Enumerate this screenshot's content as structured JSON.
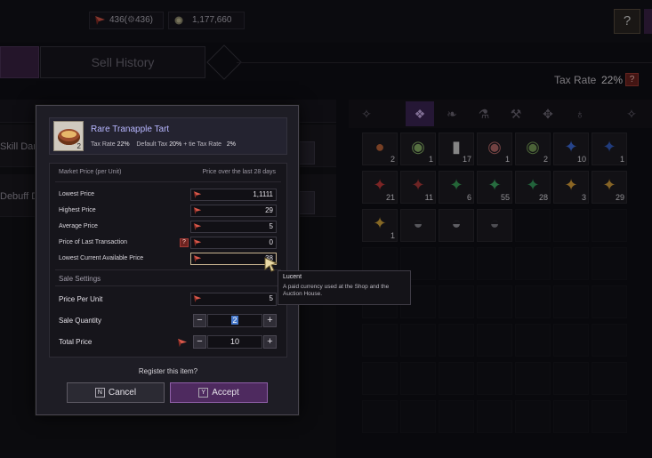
{
  "currency": {
    "lucent_text": "436(",
    "lucent_paid": "436)",
    "gold": "1,177,660"
  },
  "tabs": {
    "sell_history": "Sell History"
  },
  "tax": {
    "label": "Tax Rate",
    "value": "22%",
    "help": "?"
  },
  "left_list": {
    "row1": "Skill Dam",
    "row2": "Debuff D"
  },
  "inventory": {
    "rows": [
      [
        {
          "icon": "tart-icon",
          "glyph": "●",
          "color": "#c1673a",
          "count": "2"
        },
        {
          "icon": "plate-icon",
          "glyph": "◉",
          "color": "#8bb56a",
          "count": "1"
        },
        {
          "icon": "bottle-icon",
          "glyph": "▮",
          "color": "#d7d7d7",
          "count": "17"
        },
        {
          "icon": "plate-icon",
          "glyph": "◉",
          "color": "#b96b6b",
          "count": "1"
        },
        {
          "icon": "plate-icon",
          "glyph": "◉",
          "color": "#79a05a",
          "count": "2"
        },
        {
          "icon": "crystal-icon",
          "glyph": "✦",
          "color": "#3e6fe0",
          "count": "10"
        },
        {
          "icon": "crystal-icon",
          "glyph": "✦",
          "color": "#3560c8",
          "count": "1"
        }
      ],
      [
        {
          "icon": "crystal-icon",
          "glyph": "✦",
          "color": "#c73a3a",
          "count": "21"
        },
        {
          "icon": "crystal-icon",
          "glyph": "✦",
          "color": "#b03a3a",
          "count": "11"
        },
        {
          "icon": "crystal-icon",
          "glyph": "✦",
          "color": "#3aa35a",
          "count": "6"
        },
        {
          "icon": "crystal-icon",
          "glyph": "✦",
          "color": "#3faf66",
          "count": "55"
        },
        {
          "icon": "crystal-icon",
          "glyph": "✦",
          "color": "#37a060",
          "count": "28"
        },
        {
          "icon": "crystal-icon",
          "glyph": "✦",
          "color": "#e0a53a",
          "count": "3"
        },
        {
          "icon": "crystal-icon",
          "glyph": "✦",
          "color": "#d7a13c",
          "count": "29"
        }
      ],
      [
        {
          "icon": "crystal-icon",
          "glyph": "✦",
          "color": "#d9a83a",
          "count": "1"
        },
        {
          "icon": "helmet-icon",
          "glyph": "◒",
          "color": "#8d8d95",
          "count": ""
        },
        {
          "icon": "helmet-icon",
          "glyph": "◒",
          "color": "#9a9aa2",
          "count": ""
        },
        {
          "icon": "helmet-icon",
          "glyph": "◒",
          "color": "#7e7e86",
          "count": ""
        }
      ]
    ]
  },
  "modal": {
    "item_name": "Rare Tranapple Tart",
    "item_qty": "2",
    "tax_label": "Tax Rate",
    "tax_value": "22%",
    "default_tax_label": "Default Tax",
    "default_tax_value": "20%",
    "tie_tax_label": "+ tie Tax Rate",
    "tie_tax_value": "2%",
    "market_price_header": "Market Price (per Unit)",
    "market_price_period": "Price over the last 28 days",
    "lowest_price_label": "Lowest Price",
    "lowest_price": "1,1111",
    "highest_price_label": "Highest Price",
    "highest_price": "29",
    "average_price_label": "Average Price",
    "average_price": "5",
    "last_tx_label": "Price of Last Transaction",
    "last_tx_price": "0",
    "lowest_current_label": "Lowest Current Available Price",
    "lowest_current_price": "38",
    "sale_settings": "Sale Settings",
    "price_per_unit_label": "Price Per Unit",
    "price_per_unit": "5",
    "sale_quantity_label": "Sale Quantity",
    "sale_quantity": "2",
    "total_price_label": "Total Price",
    "total_price": "10",
    "register_question": "Register this item?",
    "cancel_key": "N",
    "cancel_label": "Cancel",
    "accept_key": "Y",
    "accept_label": "Accept"
  },
  "tooltip": {
    "title": "Lucent",
    "description": "A paid currency used at the Shop and the Auction House."
  },
  "colors": {
    "accent_purple": "#4e2a5f",
    "selection_blue": "#4577c9",
    "help_red": "#6d2320"
  }
}
